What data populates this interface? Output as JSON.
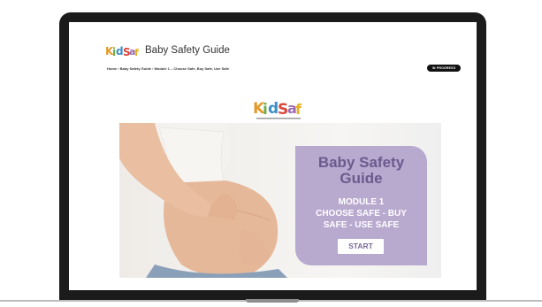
{
  "site": {
    "logo_text": "Kid Safe",
    "title": "Baby Safety Guide",
    "breadcrumb": "Home › Baby Safety Guide › Module 1 – Choose Safe, Buy Safe, Use Safe",
    "status": "IN PROGRESS"
  },
  "hero": {
    "card_title": "Baby Safety\nGuide",
    "card_subtitle": "MODULE 1\nCHOOSE SAFE - BUY\nSAFE - USE SAFE",
    "button_label": "START"
  },
  "colors": {
    "card_bg": "#b8a9cf",
    "card_title": "#6b5a8d",
    "button_text": "#7a6a98",
    "pill_bg": "#111111"
  },
  "icons": [
    "kidsafe-logo-icon",
    "kidsafe-logo-center-icon",
    "pregnant-woman-image"
  ]
}
